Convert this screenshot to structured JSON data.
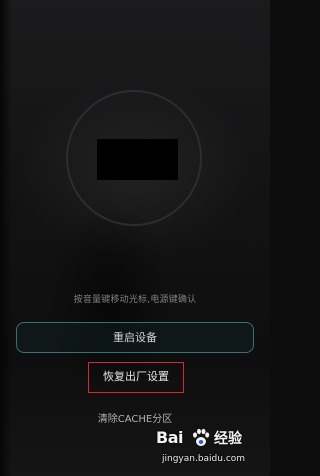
{
  "screen": {
    "hint_text": "按音量键移动光标,电源键确认",
    "menu": {
      "reboot_label": "重启设备",
      "factory_reset_label": "恢复出厂设置",
      "clear_cache_label": "清除CACHE分区"
    },
    "highlight_color": "#d8262f",
    "accent_color": "#3b6f76"
  },
  "watermark": {
    "logo_text": "Bai",
    "logo_suffix": "经验",
    "url": "jingyan.baidu.com",
    "icon": "baidu-paw-icon"
  }
}
